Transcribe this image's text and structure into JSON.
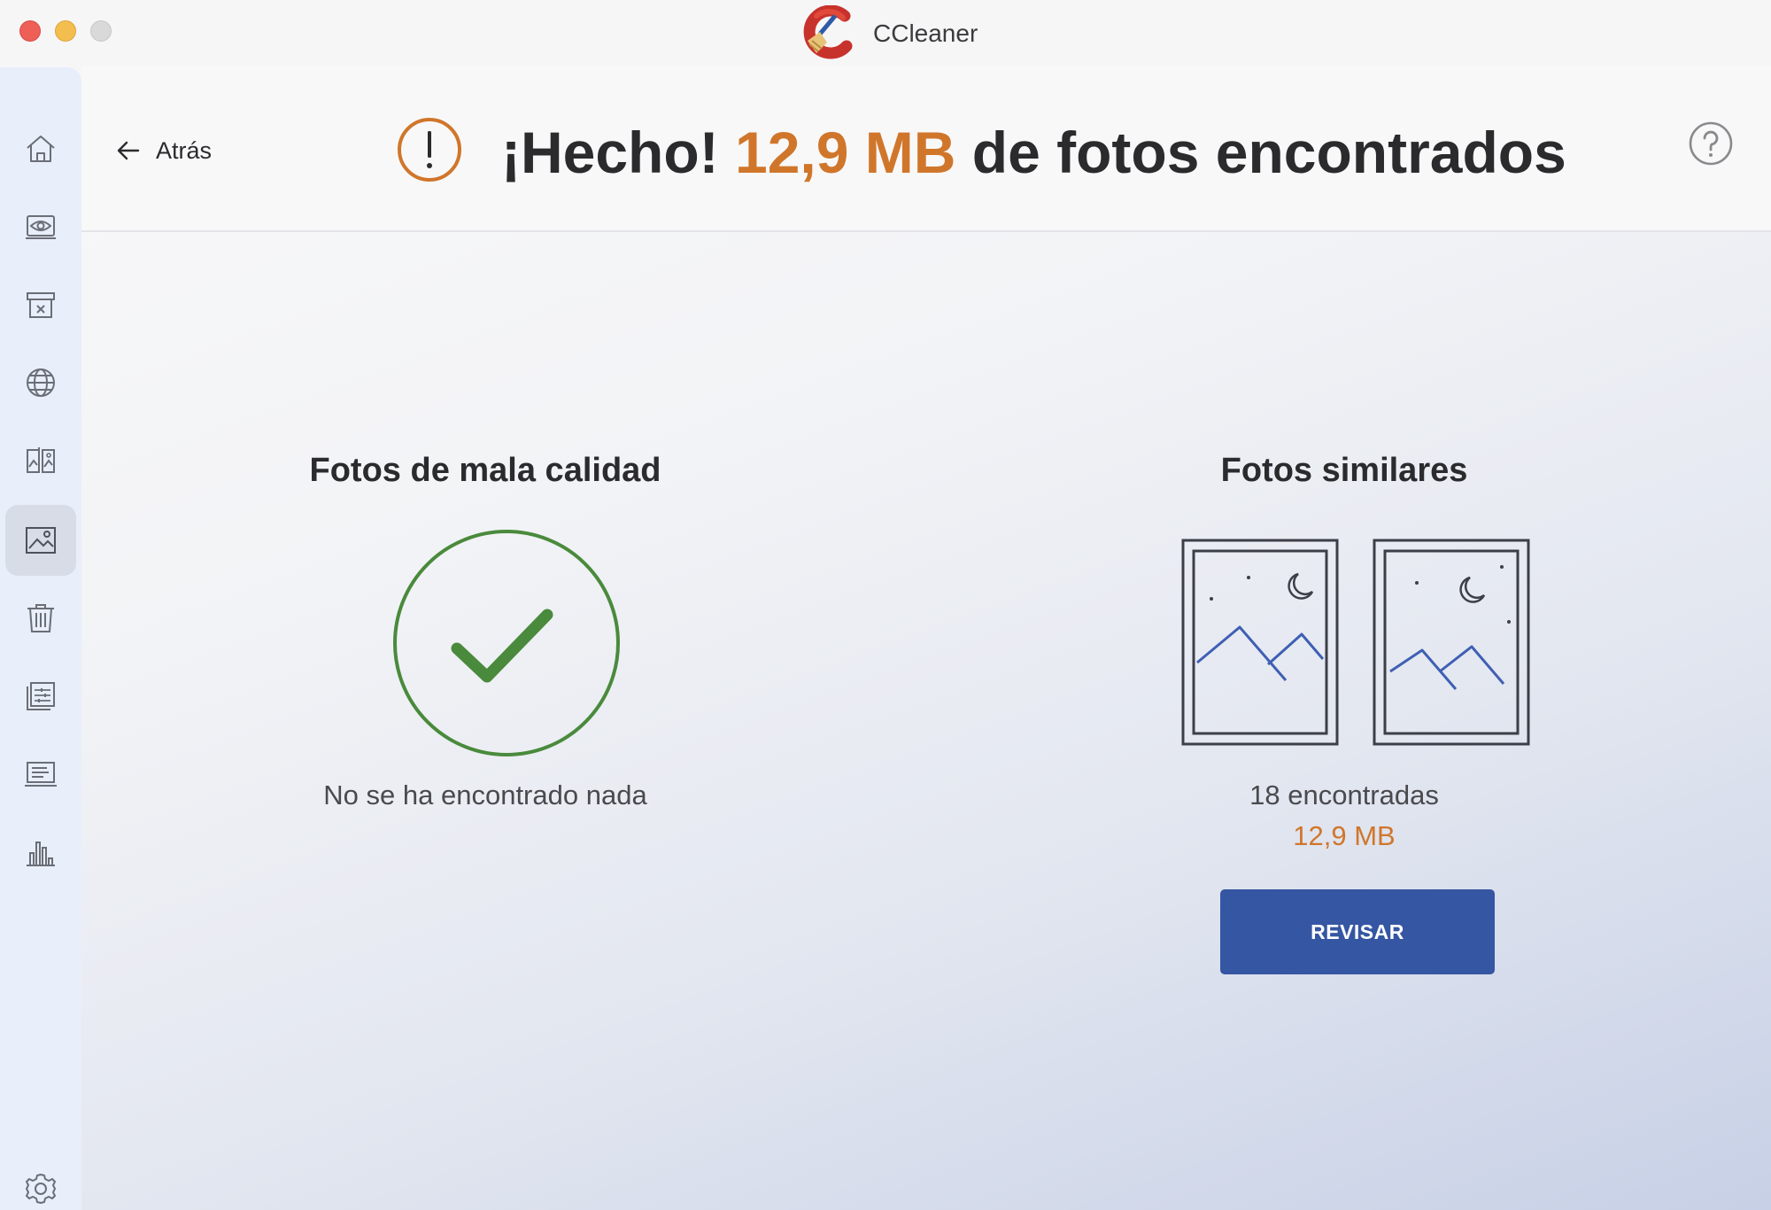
{
  "window": {
    "app_title": "CCleaner"
  },
  "sidebar": {
    "items": [
      {
        "icon": "home-icon"
      },
      {
        "icon": "health-check-icon"
      },
      {
        "icon": "cleaner-icon"
      },
      {
        "icon": "browser-icon"
      },
      {
        "icon": "duplicate-finder-icon"
      },
      {
        "icon": "photo-icon",
        "active": true
      },
      {
        "icon": "trash-icon"
      },
      {
        "icon": "startup-manager-icon"
      },
      {
        "icon": "software-updater-icon"
      },
      {
        "icon": "disk-analyzer-icon"
      },
      {
        "icon": "settings-icon"
      }
    ]
  },
  "header": {
    "back_label": "Atrás",
    "headline_prefix": "¡Hecho! ",
    "headline_amount": "12,9 MB",
    "headline_suffix": " de fotos encontrados"
  },
  "bad_photos": {
    "title": "Fotos de mala calidad",
    "status": "No se ha encontrado nada"
  },
  "similar_photos": {
    "title": "Fotos similares",
    "count_text": "18 encontradas",
    "size_text": "12,9 MB",
    "button_label": "REVISAR"
  },
  "colors": {
    "accent": "#d0762b",
    "primary_button": "#3556a2",
    "success": "#4a8a3c",
    "sidebar_bg": "#e8eefa"
  }
}
